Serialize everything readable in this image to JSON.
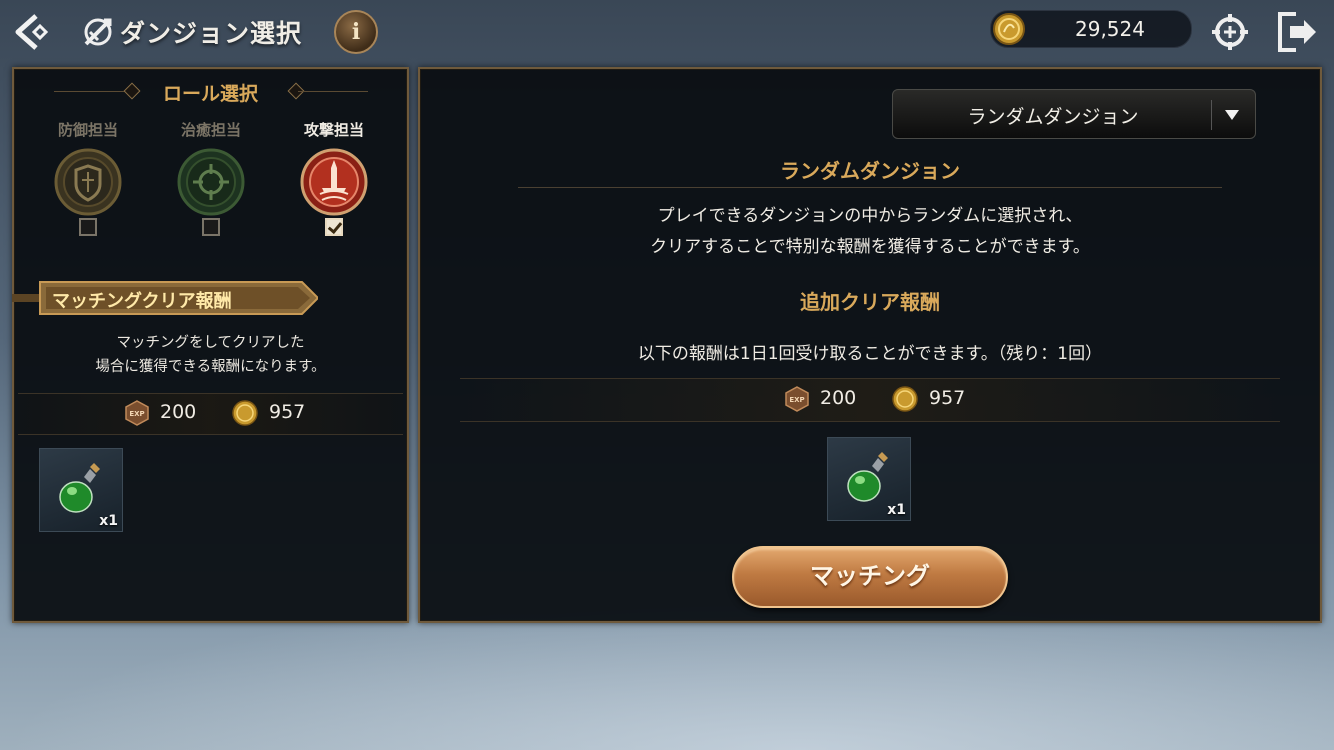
{
  "header": {
    "title": "ダンジョン選択",
    "info_label": "i",
    "gold": "29,524"
  },
  "role_select": {
    "heading": "ロール選択",
    "roles": [
      {
        "label": "防御担当",
        "checked": false
      },
      {
        "label": "治癒担当",
        "checked": false
      },
      {
        "label": "攻撃担当",
        "checked": true
      }
    ]
  },
  "matching_reward": {
    "banner": "マッチングクリア報酬",
    "desc_line1": "マッチングをしてクリアした",
    "desc_line2": "場合に獲得できる報酬になります。",
    "exp": "200",
    "gold": "957",
    "item_qty": "x1"
  },
  "dungeon": {
    "dropdown_value": "ランダムダンジョン",
    "heading": "ランダムダンジョン",
    "desc_line1": "プレイできるダンジョンの中からランダムに選択され、",
    "desc_line2": "クリアすることで特別な報酬を獲得することができます。",
    "bonus_heading": "追加クリア報酬",
    "daily_note": "以下の報酬は1日1回受け取ることができます。（残り：1回）",
    "exp": "200",
    "gold": "957",
    "item_qty": "x1",
    "match_button": "マッチング"
  },
  "icons": {
    "back": "back-arrow-icon",
    "title": "dungeon-swords-icon",
    "coin": "gold-coin-icon",
    "exp": "exp-badge-icon",
    "crosshair": "crosshair-add-icon",
    "exit": "exit-icon",
    "potion": "green-potion-icon"
  },
  "colors": {
    "accent_gold": "#d9a95b",
    "panel_border": "#6f5a3c",
    "button_orange": "#bf7a42"
  }
}
